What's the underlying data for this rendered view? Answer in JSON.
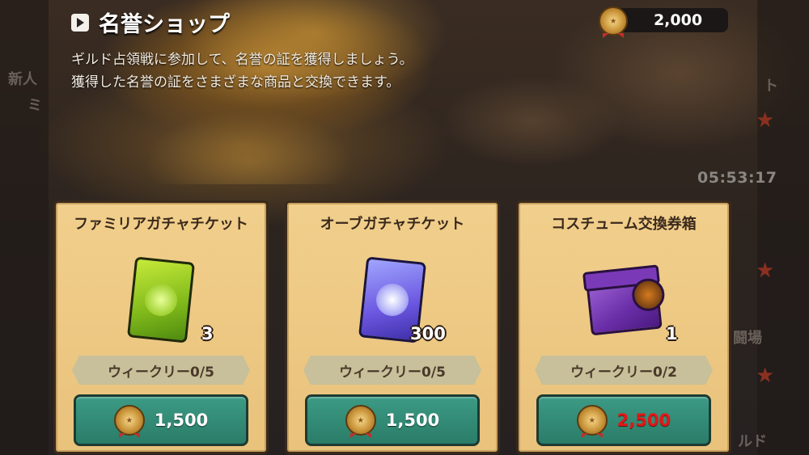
{
  "header": {
    "title": "名誉ショップ",
    "description_line1": "ギルド占領戦に参加して、名誉の証を獲得しましょう。",
    "description_line2": "獲得した名誉の証をさまざまな商品と交換できます。",
    "currency_amount": "2,000"
  },
  "background": {
    "left_text1": "新人",
    "left_text2": "ミ",
    "right_text1": "ト",
    "right_text2": "闘場",
    "right_text3": "ルド",
    "timer": "05:53:17"
  },
  "items": [
    {
      "name": "ファミリアガチャチケット",
      "quantity": "3",
      "limit": "ウィークリー0/5",
      "price": "1,500",
      "icon": "green-ticket-icon",
      "affordable": true
    },
    {
      "name": "オーブガチャチケット",
      "quantity": "300",
      "limit": "ウィークリー0/5",
      "price": "1,500",
      "icon": "blue-ticket-icon",
      "affordable": true
    },
    {
      "name": "コスチューム交換券箱",
      "quantity": "1",
      "limit": "ウィークリー0/2",
      "price": "2,500",
      "icon": "purple-box-icon",
      "affordable": false
    }
  ],
  "colors": {
    "card_bg": "#f1cf8c",
    "buy_button": "#2a7c68",
    "insufficient_price": "#e01818"
  }
}
